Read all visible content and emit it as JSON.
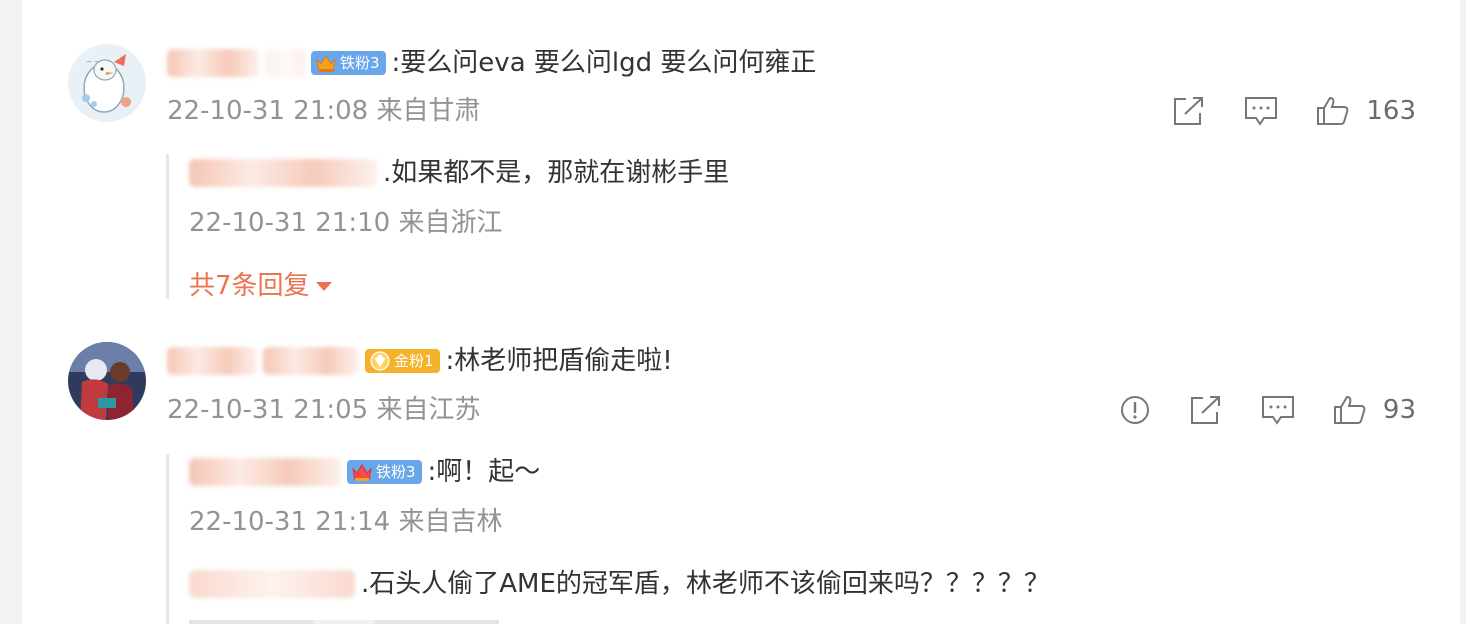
{
  "comments": [
    {
      "badge": "铁粉3",
      "text": ":要么问eva 要么问lgd 要么问何雍正",
      "time": "22-10-31 21:08 来自甘肃",
      "likes": "163",
      "icons": [
        "share-icon",
        "comment-icon",
        "like-icon"
      ],
      "replies": [
        {
          "text": ".如果都不是，那就在谢彬手里",
          "time": "22-10-31 21:10 来自浙江"
        }
      ],
      "more_replies": "共7条回复"
    },
    {
      "badge": "金粉1",
      "text": ":林老师把盾偷走啦!",
      "time": "22-10-31 21:05 来自江苏",
      "likes": "93",
      "icons": [
        "report-icon",
        "share-icon",
        "comment-icon",
        "like-icon"
      ],
      "replies": [
        {
          "badge": "铁粉3",
          "text": ":啊！起～",
          "time": "22-10-31 21:14 来自吉林"
        },
        {
          "text": ".石头人偷了AME的冠军盾，林老师不该偷回来吗？？？？？"
        }
      ]
    }
  ],
  "colors": {
    "accent": "#eb7350",
    "meta": "#939393",
    "iron_badge": "#6aa7ea",
    "gold_badge": "#f3b22a"
  }
}
